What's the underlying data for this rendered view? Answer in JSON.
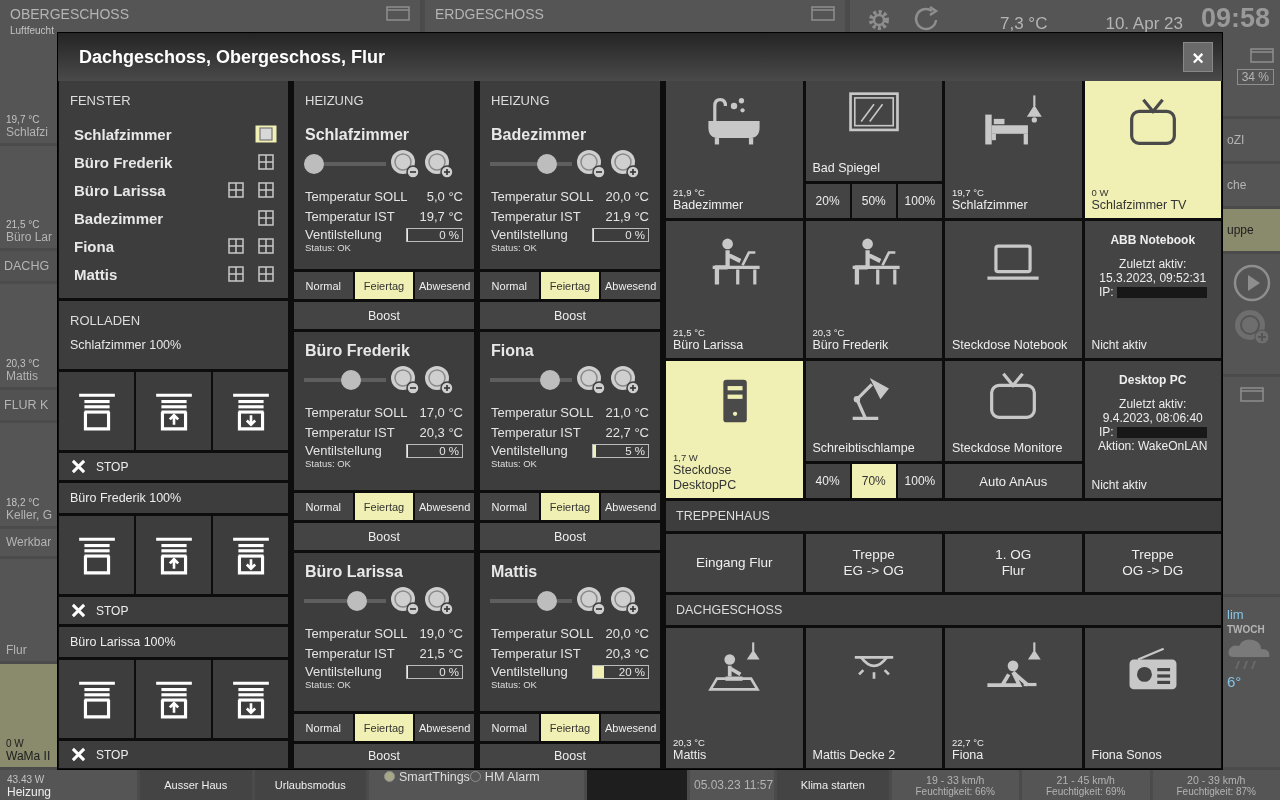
{
  "background": {
    "top": [
      {
        "title": "OBERGESCHOSS",
        "subtitle": "Luftfeucht"
      },
      {
        "title": "ERDGESCHOSS"
      }
    ],
    "status": {
      "temperature": "7,3 °C",
      "date": "10. Apr 23",
      "time": "09:58"
    },
    "left": [
      {
        "kind": "tile",
        "value": "19,7 °C",
        "label": "Schlafzi",
        "on": false
      },
      {
        "kind": "tile",
        "value": "21,5 °C",
        "label": "Büro Lar",
        "on": false
      },
      {
        "kind": "header",
        "label": "DACHG"
      },
      {
        "kind": "tile",
        "value": "20,3 °C",
        "label": "Mattis",
        "on": false
      },
      {
        "kind": "header",
        "label": "FLUR K"
      },
      {
        "kind": "tile",
        "value": "18,2 °C",
        "label": "Keller, G",
        "on": false
      },
      {
        "kind": "row",
        "label": "Werkbar"
      },
      {
        "kind": "tile",
        "label": "Flur",
        "on": false
      },
      {
        "kind": "tile",
        "value": "0 W",
        "label": "WaMa II",
        "on": true
      }
    ],
    "right": [
      {
        "kind": "gauge",
        "value": "34 %"
      },
      {
        "kind": "row",
        "label": "oZI",
        "on": false
      },
      {
        "kind": "row",
        "label": "che",
        "on": false
      },
      {
        "kind": "row",
        "label": "uppe",
        "on": true
      },
      {
        "kind": "player"
      },
      {
        "kind": "window"
      },
      {
        "kind": "weather",
        "place": "lim",
        "day": "TWOCH",
        "temp": "6°"
      }
    ],
    "bottom": [
      {
        "kind": "tile",
        "value": "43.43 W",
        "label": "Heizung"
      },
      {
        "kind": "mode",
        "label": "Ausser Haus"
      },
      {
        "kind": "mode",
        "label": "Urlaubsmodus"
      },
      {
        "kind": "status",
        "items": [
          {
            "label": "SmartThings",
            "on": true
          },
          {
            "label": "HM Alarm",
            "on": false
          }
        ]
      },
      {
        "kind": "screen"
      },
      {
        "kind": "time",
        "label": "05.03.23 11:57"
      },
      {
        "kind": "mode",
        "label": "Klima starten"
      },
      {
        "kind": "wind",
        "wind": "19 - 33 km/h",
        "humidity": "Feuchtigkeit: 66%"
      },
      {
        "kind": "wind",
        "wind": "21 - 45 km/h",
        "humidity": "Feuchtigkeit: 69%"
      },
      {
        "kind": "wind",
        "wind": "20 - 39 km/h",
        "humidity": "Feuchtigkeit: 87%"
      }
    ]
  },
  "dialog": {
    "title": "Dachgeschoss, Obergeschoss, Flur",
    "close": "×"
  },
  "windows": {
    "title": "FENSTER",
    "rooms": [
      {
        "name": "Schlafzimmer",
        "windows": [
          {
            "open": true
          }
        ]
      },
      {
        "name": "Büro Frederik",
        "windows": [
          {
            "open": false
          }
        ]
      },
      {
        "name": "Büro Larissa",
        "windows": [
          {
            "open": false
          },
          {
            "open": false
          }
        ]
      },
      {
        "name": "Badezimmer",
        "windows": [
          {
            "open": false
          }
        ]
      },
      {
        "name": "Fiona",
        "windows": [
          {
            "open": false
          },
          {
            "open": false
          }
        ]
      },
      {
        "name": "Mattis",
        "windows": [
          {
            "open": false
          },
          {
            "open": false
          }
        ]
      }
    ]
  },
  "blinds": {
    "title": "ROLLADEN",
    "groups": [
      {
        "label": "Schlafzimmer 100%",
        "stop": "STOP"
      },
      {
        "label": "Büro Frederik 100%",
        "stop": "STOP"
      },
      {
        "label": "Büro Larissa 100%",
        "stop": "STOP"
      }
    ]
  },
  "heating": [
    {
      "title": "HEIZUNG",
      "rooms": [
        {
          "name": "Schlafzimmer",
          "level": 0,
          "soll_label": "Temperatur SOLL",
          "soll": "5,0 °C",
          "ist_label": "Temperatur IST",
          "ist": "19,7 °C",
          "valve_label": "Ventilstellung",
          "valve": {
            "reading": "0 %",
            "level": 0
          },
          "status": "Status: OK",
          "modes": [
            {
              "label": "Normal",
              "selected": false
            },
            {
              "label": "Feiertag",
              "selected": true
            },
            {
              "label": "Abwesend",
              "selected": false
            }
          ],
          "boost": "Boost"
        },
        {
          "name": "Büro Frederik",
          "level": 0.6,
          "soll_label": "Temperatur SOLL",
          "soll": "17,0 °C",
          "ist_label": "Temperatur IST",
          "ist": "20,3 °C",
          "valve_label": "Ventilstellung",
          "valve": {
            "reading": "0 %",
            "level": 0
          },
          "status": "Status: OK",
          "modes": [
            {
              "label": "Normal",
              "selected": false
            },
            {
              "label": "Feiertag",
              "selected": true
            },
            {
              "label": "Abwesend",
              "selected": false
            }
          ],
          "boost": "Boost"
        },
        {
          "name": "Büro Larissa",
          "level": 0.7,
          "soll_label": "Temperatur SOLL",
          "soll": "19,0 °C",
          "ist_label": "Temperatur IST",
          "ist": "21,5 °C",
          "valve_label": "Ventilstellung",
          "valve": {
            "reading": "0 %",
            "level": 0
          },
          "status": "Status: OK",
          "modes": [
            {
              "label": "Normal",
              "selected": false
            },
            {
              "label": "Feiertag",
              "selected": true
            },
            {
              "label": "Abwesend",
              "selected": false
            }
          ],
          "boost": "Boost"
        }
      ]
    },
    {
      "title": "HEIZUNG",
      "rooms": [
        {
          "name": "Badezimmer",
          "level": 0.75,
          "soll_label": "Temperatur SOLL",
          "soll": "20,0 °C",
          "ist_label": "Temperatur IST",
          "ist": "21,9 °C",
          "valve_label": "Ventilstellung",
          "valve": {
            "reading": "0 %",
            "level": 0
          },
          "status": "Status: OK",
          "modes": [
            {
              "label": "Normal",
              "selected": false
            },
            {
              "label": "Feiertag",
              "selected": true
            },
            {
              "label": "Abwesend",
              "selected": false
            }
          ],
          "boost": "Boost"
        },
        {
          "name": "Fiona",
          "level": 0.8,
          "soll_label": "Temperatur SOLL",
          "soll": "21,0 °C",
          "ist_label": "Temperatur IST",
          "ist": "22,7 °C",
          "valve_label": "Ventilstellung",
          "valve": {
            "reading": "5 %",
            "level": 0.05
          },
          "status": "Status: OK",
          "modes": [
            {
              "label": "Normal",
              "selected": false
            },
            {
              "label": "Feiertag",
              "selected": true
            },
            {
              "label": "Abwesend",
              "selected": false
            }
          ],
          "boost": "Boost"
        },
        {
          "name": "Mattis",
          "level": 0.75,
          "soll_label": "Temperatur SOLL",
          "soll": "20,0 °C",
          "ist_label": "Temperatur IST",
          "ist": "20,3 °C",
          "valve_label": "Ventilstellung",
          "valve": {
            "reading": "20 %",
            "level": 0.2
          },
          "status": "Status: OK",
          "modes": [
            {
              "label": "Normal",
              "selected": false
            },
            {
              "label": "Feiertag",
              "selected": true
            },
            {
              "label": "Abwesend",
              "selected": false
            }
          ],
          "boost": "Boost"
        }
      ]
    }
  ],
  "devices": {
    "tiles": [
      {
        "kind": "sensor",
        "value": "21,9 °C",
        "label": "Badezimmer",
        "on": false
      },
      {
        "kind": "dimmer",
        "label": "Bad Spiegel",
        "levels": [
          {
            "label": "20%",
            "selected": false
          },
          {
            "label": "50%",
            "selected": false
          },
          {
            "label": "100%",
            "selected": false
          }
        ]
      },
      {
        "kind": "sensor",
        "value": "19,7 °C",
        "label": "Schlafzimmer",
        "on": false
      },
      {
        "kind": "sensor",
        "value": "0 W",
        "label": "Schlafzimmer TV",
        "on": true
      },
      {
        "kind": "sensor",
        "value": "21,5 °C",
        "label": "Büro Larissa",
        "on": false
      },
      {
        "kind": "sensor",
        "value": "20,3 °C",
        "label": "Büro Frederik",
        "on": false
      },
      {
        "kind": "sensor",
        "label": "Steckdose Notebook",
        "on": false
      },
      {
        "kind": "info",
        "title": "ABB Notebook",
        "lines": [
          "Zuletzt aktiv:",
          "15.3.2023, 09:52:31"
        ],
        "ip_label": "IP:",
        "status": "Nicht aktiv"
      },
      {
        "kind": "sensor",
        "value": "1,7 W",
        "label": "Steckdose DesktopPC",
        "on": true
      },
      {
        "kind": "dimmer",
        "label": "Schreibtischlampe",
        "levels": [
          {
            "label": "40%",
            "selected": false
          },
          {
            "label": "70%",
            "selected": true
          },
          {
            "label": "100%",
            "selected": false
          }
        ]
      },
      {
        "kind": "action",
        "label": "Steckdose Monitore",
        "button": "Auto AnAus"
      },
      {
        "kind": "info",
        "title": "Desktop PC",
        "lines": [
          "Zuletzt aktiv:",
          "9.4.2023, 08:06:40"
        ],
        "ip_label": "IP:",
        "extra": [
          "Aktion: WakeOnLAN"
        ],
        "status": "Nicht aktiv"
      }
    ],
    "sections": [
      {
        "kind": "buttons",
        "title": "TREPPENHAUS",
        "buttons": [
          {
            "lines": [
              "Eingang Flur"
            ]
          },
          {
            "lines": [
              "Treppe",
              "EG -> OG"
            ]
          },
          {
            "lines": [
              "1. OG",
              "Flur"
            ]
          },
          {
            "lines": [
              "Treppe",
              "OG -> DG"
            ]
          }
        ]
      },
      {
        "kind": "tiles",
        "title": "DACHGESCHOSS",
        "tiles": [
          {
            "kind": "sensor",
            "value": "20,3 °C",
            "label": "Mattis",
            "on": false
          },
          {
            "kind": "sensor",
            "label": "Mattis Decke 2",
            "on": false
          },
          {
            "kind": "sensor",
            "value": "22,7 °C",
            "label": "Fiona",
            "on": false
          },
          {
            "kind": "sensor",
            "label": "Fiona Sonos",
            "on": false
          }
        ]
      }
    ]
  }
}
